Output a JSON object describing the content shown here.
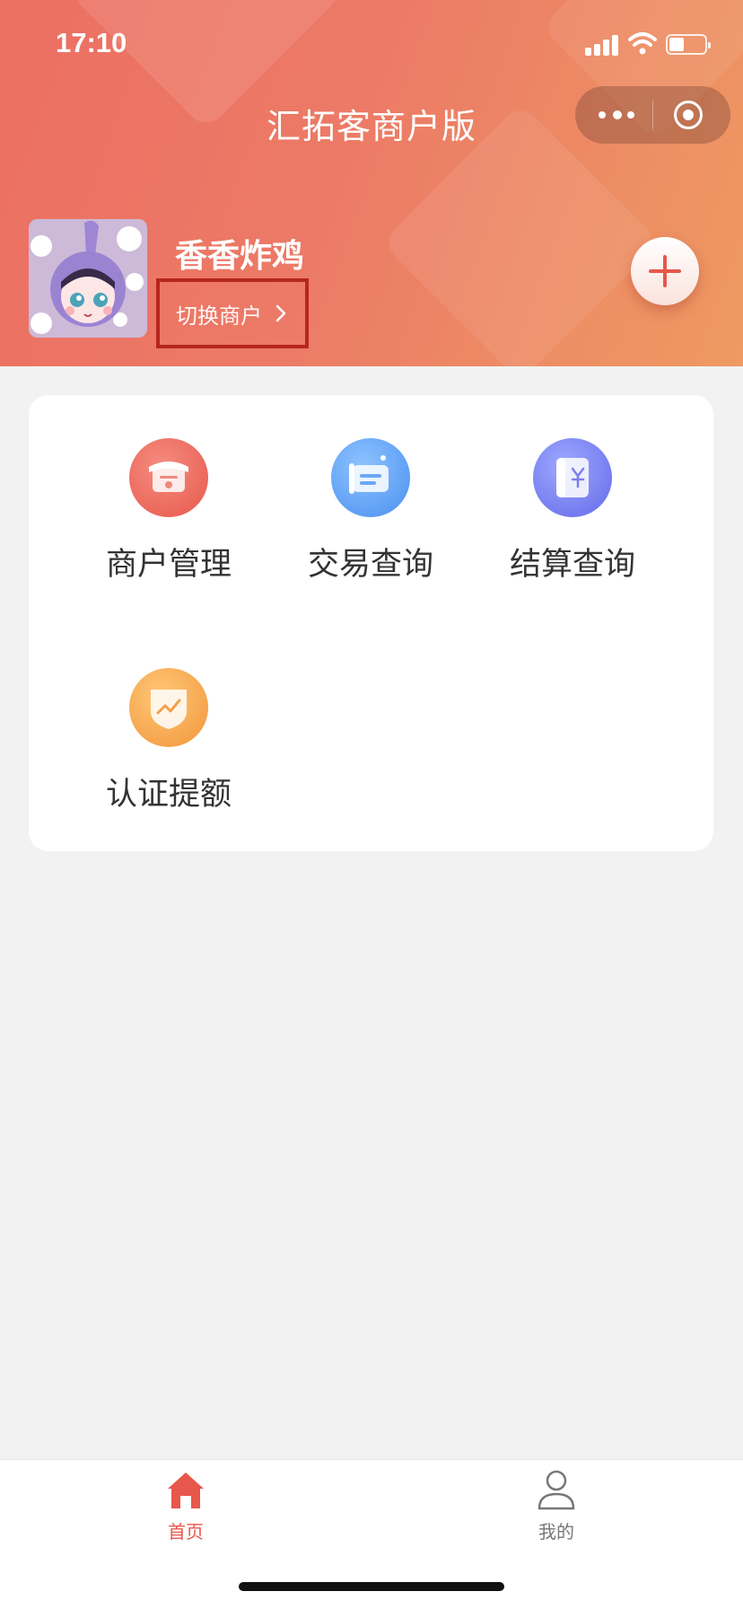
{
  "status_bar": {
    "time": "17:10"
  },
  "header": {
    "app_title": "汇拓客商户版",
    "merchant_name": "香香炸鸡",
    "switch_merchant_label": "切换商户"
  },
  "menu": {
    "items": [
      {
        "label": "商户管理",
        "icon": "store-icon",
        "color": "#ec6a5e"
      },
      {
        "label": "交易查询",
        "icon": "transaction-icon",
        "color": "#5d9cf2"
      },
      {
        "label": "结算查询",
        "icon": "settlement-icon",
        "color": "#7278ee"
      },
      {
        "label": "认证提额",
        "icon": "certification-icon",
        "color": "#f3a048"
      }
    ]
  },
  "tabbar": {
    "tabs": [
      {
        "label": "首页",
        "icon": "home-icon",
        "active": true
      },
      {
        "label": "我的",
        "icon": "user-icon",
        "active": false
      }
    ]
  },
  "colors": {
    "header_start": "#ec6f63",
    "header_end": "#ee9a62",
    "accent": "#e8574b",
    "highlight_box": "#b6261c"
  }
}
